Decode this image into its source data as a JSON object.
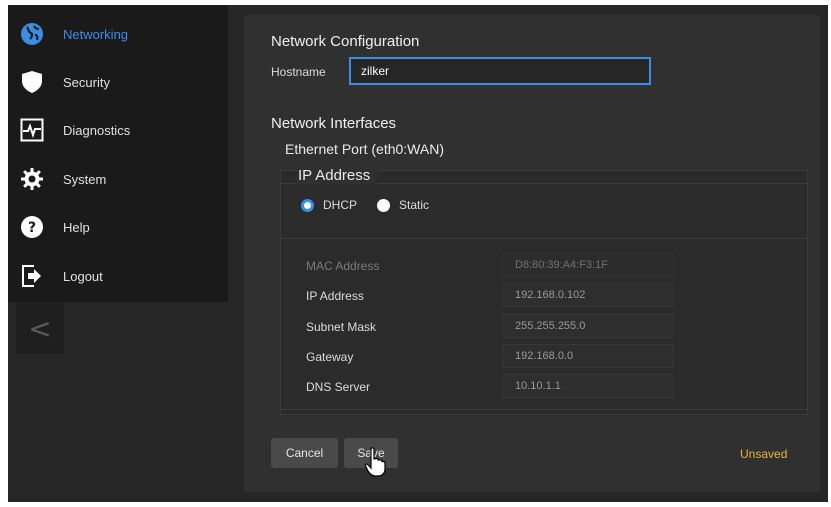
{
  "sidebar": {
    "items": [
      {
        "label": "Networking",
        "icon": "globe-icon",
        "active": true
      },
      {
        "label": "Security",
        "icon": "shield-icon",
        "active": false
      },
      {
        "label": "Diagnostics",
        "icon": "pulse-icon",
        "active": false
      },
      {
        "label": "System",
        "icon": "gear-icon",
        "active": false
      },
      {
        "label": "Help",
        "icon": "help-icon",
        "active": false
      },
      {
        "label": "Logout",
        "icon": "logout-icon",
        "active": false
      }
    ],
    "collapse_glyph": "<"
  },
  "network_config": {
    "title": "Network Configuration",
    "hostname_label": "Hostname",
    "hostname_value": "zilker"
  },
  "interfaces": {
    "title": "Network Interfaces",
    "port_title": "Ethernet Port (eth0:WAN)",
    "ip_title": "IP Address",
    "modes": [
      {
        "label": "DHCP",
        "checked": true
      },
      {
        "label": "Static",
        "checked": false
      }
    ],
    "fields": [
      {
        "label": "MAC Address",
        "value": "D8:80:39:A4:F3:1F",
        "dim": true
      },
      {
        "label": "IP Address",
        "value": "192.168.0.102",
        "dim": false
      },
      {
        "label": "Subnet Mask",
        "value": "255.255.255.0",
        "dim": false
      },
      {
        "label": "Gateway",
        "value": "192.168.0.0",
        "dim": false
      },
      {
        "label": "DNS Server",
        "value": "10.10.1.1",
        "dim": false
      }
    ]
  },
  "actions": {
    "cancel_label": "Cancel",
    "save_label": "Save",
    "status_text": "Unsaved"
  },
  "colors": {
    "accent": "#3a8ee6",
    "status": "#e8b53a",
    "background": "#262626"
  }
}
